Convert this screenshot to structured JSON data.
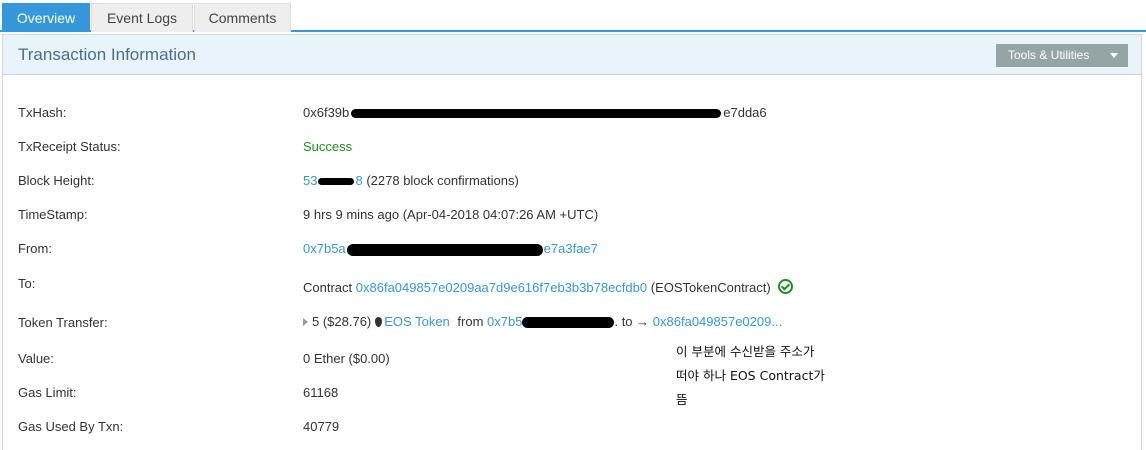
{
  "tabs": [
    {
      "label": "Overview"
    },
    {
      "label": "Event Logs"
    },
    {
      "label": "Comments"
    }
  ],
  "panel": {
    "title": "Transaction Information",
    "tools_label": "Tools & Utilities"
  },
  "rows": {
    "txhash": {
      "label": "TxHash:",
      "prefix": "0x6f39b",
      "suffix": "e7dda6"
    },
    "status": {
      "label": "TxReceipt Status:",
      "value": "Success"
    },
    "block": {
      "label": "Block Height:",
      "link_prefix": "53",
      "link_suffix": "8",
      "confirmations": "(2278 block confirmations)"
    },
    "timestamp": {
      "label": "TimeStamp:",
      "value": "9 hrs 9 mins ago (Apr-04-2018 04:07:26 AM +UTC)"
    },
    "from": {
      "label": "From:",
      "prefix": "0x7b5a",
      "suffix": "e7a3fae7"
    },
    "to": {
      "label": "To:",
      "contract_word": "Contract",
      "address": "0x86fa049857e0209aa7d9e616f7eb3b3b78ecfdb0",
      "name": "(EOSTokenContract)"
    },
    "token": {
      "label": "Token Transfer:",
      "amount": "5 ($28.76)",
      "token_name": "EOS Token",
      "from_word": "from",
      "from_prefix": "0x7b5",
      "to_word": ". to →",
      "to_address": "0x86fa049857e0209..."
    },
    "value": {
      "label": "Value:",
      "value": "0 Ether ($0.00)"
    },
    "gas_limit": {
      "label": "Gas Limit:",
      "value": "61168"
    },
    "gas_used": {
      "label": "Gas Used By Txn:",
      "value": "40779"
    }
  },
  "annotation": {
    "line1": "이 부분에 수신받을 주소가",
    "line2": "떠야 하나 EOS Contract가",
    "line3": "뜸"
  },
  "colors": {
    "accent": "#3498db",
    "success": "#1e8c1e",
    "header_bg": "#e8f3fb",
    "tools_bg": "#95a5a6"
  }
}
